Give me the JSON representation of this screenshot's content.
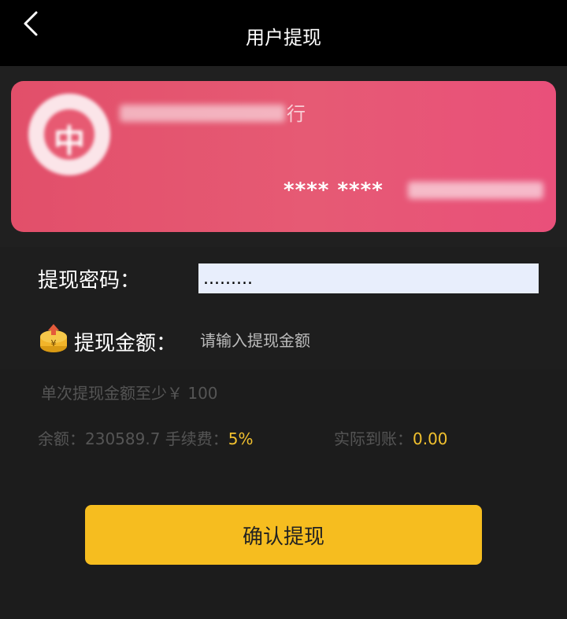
{
  "header": {
    "title": "用户提现",
    "back_icon": "chevron-left-icon"
  },
  "card": {
    "bank_name_visible": "行",
    "card_number_prefix": "**** ****",
    "gradient_colors": [
      "#e24f6a",
      "#e9507a"
    ]
  },
  "form": {
    "password_label": "提现密码：",
    "password_value": ".........",
    "amount_label": "提现金额：",
    "amount_placeholder": "请输入提现金额",
    "amount_icon": "coin-upload-icon"
  },
  "info": {
    "min_amount_note": "单次提现金额至少￥ 100",
    "balance_label": "余额：",
    "balance_value": "230589.7",
    "fee_label": "手续费：",
    "fee_value": "5%",
    "actual_label": "实际到账：",
    "actual_value": "0.00",
    "accent_color": "#f2c12e"
  },
  "confirm_button": {
    "label": "确认提现",
    "color": "#f6bd1f"
  }
}
